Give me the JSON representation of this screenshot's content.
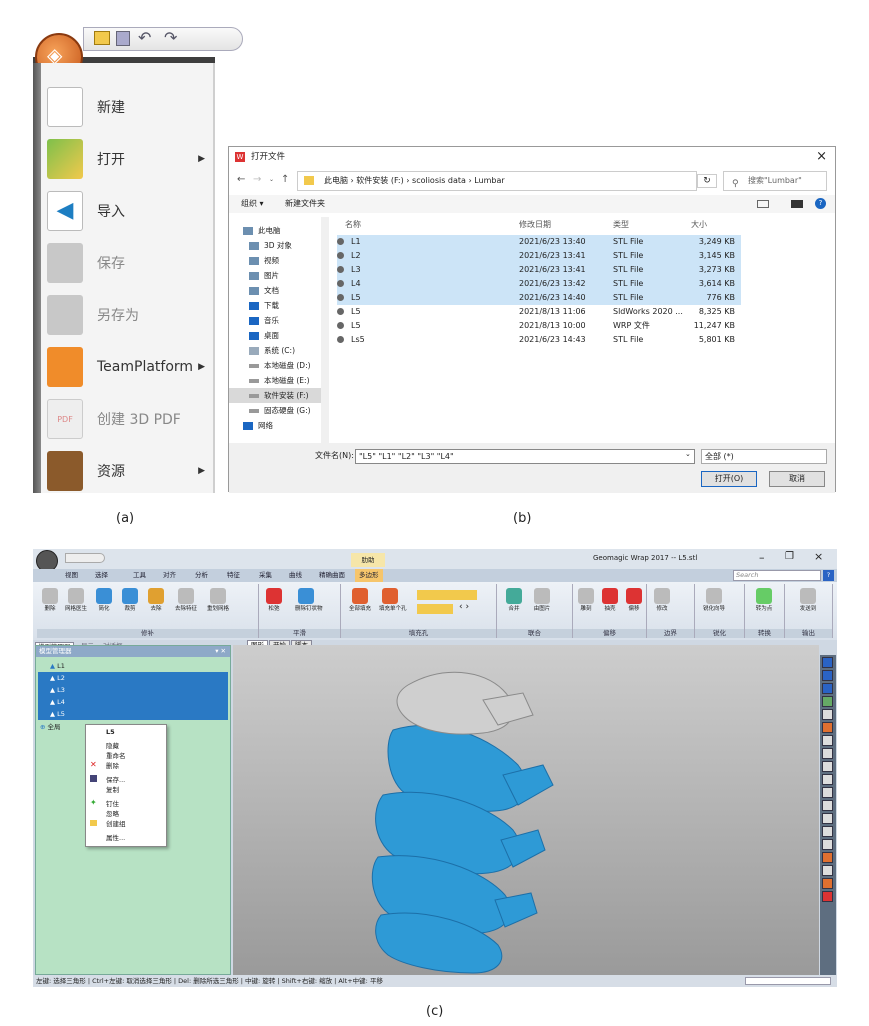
{
  "panel_a": {
    "quick_access": [
      "open-folder-icon",
      "save-icon",
      "undo-icon",
      "redo-icon"
    ],
    "menu_items": [
      {
        "label": "新建",
        "icon": "new-document-icon",
        "has_submenu": false,
        "enabled": true
      },
      {
        "label": "打开",
        "icon": "open-folder-icon",
        "has_submenu": true,
        "enabled": true
      },
      {
        "label": "导入",
        "icon": "import-icon",
        "has_submenu": false,
        "enabled": true
      },
      {
        "label": "保存",
        "icon": "save-icon",
        "has_submenu": false,
        "enabled": false
      },
      {
        "label": "另存为",
        "icon": "save-as-icon",
        "has_submenu": false,
        "enabled": false
      },
      {
        "label": "TeamPlatform",
        "icon": "cloud-icon",
        "has_submenu": true,
        "enabled": true
      },
      {
        "label": "创建 3D PDF",
        "icon": "pdf-icon",
        "has_submenu": false,
        "enabled": false
      },
      {
        "label": "资源",
        "icon": "book-icon",
        "has_submenu": true,
        "enabled": true
      }
    ],
    "caption": "(a)"
  },
  "panel_b": {
    "title": "打开文件",
    "close": "×",
    "breadcrumb": "此电脑 › 软件安装 (F:) › scoliosis data › Lumbar",
    "search_placeholder": "搜索\"Lumbar\"",
    "toolbar_organize": "组织 ▾",
    "toolbar_new_folder": "新建文件夹",
    "nav_items": [
      "此电脑",
      "3D 对象",
      "视频",
      "图片",
      "文档",
      "下载",
      "音乐",
      "桌面",
      "系统 (C:)",
      "本地磁盘 (D:)",
      "本地磁盘 (E:)",
      "软件安装 (F:)",
      "固态硬盘 (G:)",
      "网络"
    ],
    "columns": {
      "name": "名称",
      "date": "修改日期",
      "type": "类型",
      "size": "大小"
    },
    "files": [
      {
        "name": "L1",
        "date": "2021/6/23 13:40",
        "type": "STL File",
        "size": "3,249 KB",
        "selected": true
      },
      {
        "name": "L2",
        "date": "2021/6/23 13:41",
        "type": "STL File",
        "size": "3,145 KB",
        "selected": true
      },
      {
        "name": "L3",
        "date": "2021/6/23 13:41",
        "type": "STL File",
        "size": "3,273 KB",
        "selected": true
      },
      {
        "name": "L4",
        "date": "2021/6/23 13:42",
        "type": "STL File",
        "size": "3,614 KB",
        "selected": true
      },
      {
        "name": "L5",
        "date": "2021/6/23 14:40",
        "type": "STL File",
        "size": "776 KB",
        "selected": true
      },
      {
        "name": "L5",
        "date": "2021/8/13 11:06",
        "type": "SldWorks 2020 ...",
        "size": "8,325 KB",
        "selected": false
      },
      {
        "name": "L5",
        "date": "2021/8/13 10:00",
        "type": "WRP 文件",
        "size": "11,247 KB",
        "selected": false
      },
      {
        "name": "Ls5",
        "date": "2021/6/23 14:43",
        "type": "STL File",
        "size": "5,801 KB",
        "selected": false
      }
    ],
    "filename_label": "文件名(N):",
    "filename_value": "\"L5\" \"L1\" \"L2\" \"L3\" \"L4\"",
    "filetype_value": "全部 (*)",
    "open_button": "打开(O)",
    "cancel_button": "取消",
    "caption": "(b)"
  },
  "panel_c": {
    "title": "Geomagic Wrap 2017 -- L5.stl",
    "context_tab": "多边形",
    "context_header": "肋助",
    "search_placeholder": "Search",
    "tabs": [
      "视图",
      "选择",
      "工具",
      "对齐",
      "分析",
      "特征",
      "采集",
      "曲线",
      "精确曲面",
      "多边形"
    ],
    "groups": [
      {
        "label": "修补",
        "buttons": [
          "删除",
          "网格医生",
          "简化",
          "裁剪",
          "去除",
          "去除特征",
          "重划网格"
        ]
      },
      {
        "label": "平滑",
        "buttons": [
          "松弛",
          "删除钉状物"
        ]
      },
      {
        "label": "填充孔",
        "buttons": [
          "全部填充",
          "填充单个孔"
        ]
      },
      {
        "label": "联合",
        "buttons": [
          "合并",
          "由图片"
        ]
      },
      {
        "label": "偏移",
        "buttons": [
          "雕刻",
          "抽壳",
          "偏移"
        ]
      },
      {
        "label": "边界",
        "buttons": [
          "修改"
        ]
      },
      {
        "label": "锐化",
        "buttons": [
          "锐化向导"
        ]
      },
      {
        "label": "转换",
        "buttons": [
          "转为点"
        ]
      },
      {
        "label": "输出",
        "buttons": [
          "发送到"
        ]
      }
    ],
    "left_tabs": [
      "模型管理器",
      "显示",
      "对话框"
    ],
    "model_manager_title": "模型管理器",
    "models": [
      "L1",
      "L2",
      "L3",
      "L4",
      "L5"
    ],
    "global_node": "全局",
    "context_menu": {
      "header": "L5",
      "items": [
        "隐藏",
        "重命名",
        "删除",
        "保存...",
        "复制",
        "钉住",
        "忽略",
        "创建组",
        "属性..."
      ]
    },
    "view_tabs": [
      "图形",
      "开始",
      "脚本"
    ],
    "status": "左键: 选择三角形 | Ctrl+左键: 取消选择三角形 | Del: 删除所选三角形 | 中键: 旋转 | Shift+右键: 缩放 | Alt+中键: 平移",
    "colors": {
      "selection": "#2a79c4",
      "spine": "#2e9ad6",
      "left_panel": "#b7e2c4"
    },
    "caption": "(c)"
  }
}
